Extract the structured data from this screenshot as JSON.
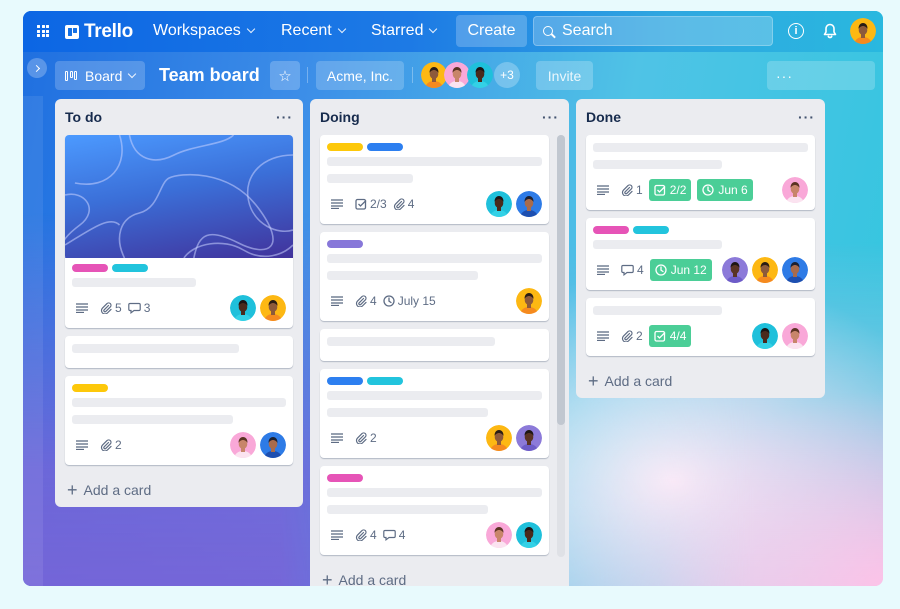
{
  "topnav": {
    "app_name": "Trello",
    "links": [
      {
        "label": "Workspaces"
      },
      {
        "label": "Recent"
      },
      {
        "label": "Starred"
      }
    ],
    "create_label": "Create",
    "search_placeholder": "Search",
    "icons": [
      "apps-grid-icon",
      "trello-logo-icon",
      "search-icon",
      "info-icon",
      "bell-icon",
      "user-avatar"
    ]
  },
  "boardbar": {
    "view_label": "Board",
    "board_title": "Team board",
    "workspace_label": "Acme, Inc.",
    "members_extra": "+3",
    "invite_label": "Invite",
    "menu_label": "···",
    "star_icon": "☆"
  },
  "colors": {
    "label_pink": "#e654b7",
    "label_cyan": "#22c4dd",
    "label_yellow": "#fdc80a",
    "label_blue": "#2d7ff0",
    "label_purple": "#8777d9",
    "badge_green": "#4bce97",
    "list_bg": "#ebecf0"
  },
  "lists": [
    {
      "title": "To do",
      "menu": "···",
      "add_card_label": "Add a card",
      "cards": [
        {
          "cover": true,
          "labels": [
            "pink",
            "cyan"
          ],
          "lines": [
            0.58
          ],
          "attachments": "5",
          "comments": "3",
          "members": [
            "teal-woman",
            "yellow-woman"
          ]
        },
        {
          "lines": [
            0.78
          ]
        },
        {
          "labels": [
            "yellow"
          ],
          "lines": [
            1.0,
            0.75
          ],
          "attachments": "2",
          "members": [
            "pink-man",
            "blue-man"
          ]
        }
      ]
    },
    {
      "title": "Doing",
      "menu": "···",
      "add_card_label": "Add a card",
      "cards": [
        {
          "labels": [
            "yellow",
            "blue"
          ],
          "lines": [
            1.0,
            0.4
          ],
          "checklist": "2/3",
          "attachments": "4",
          "members": [
            "teal-woman",
            "blue-man"
          ]
        },
        {
          "labels": [
            "purple"
          ],
          "lines": [
            1.0,
            0.7
          ],
          "attachments": "4",
          "due": "July 15",
          "members": [
            "yellow-woman"
          ]
        },
        {
          "lines": [
            0.78
          ]
        },
        {
          "labels": [
            "blue",
            "cyan"
          ],
          "lines": [
            1.0,
            0.75
          ],
          "attachments": "2",
          "members": [
            "yellow-woman",
            "purple-man"
          ]
        },
        {
          "labels": [
            "pink"
          ],
          "lines": [
            1.0,
            0.75
          ],
          "attachments": "4",
          "comments": "4",
          "members": [
            "pink-man",
            "teal-woman"
          ]
        }
      ]
    },
    {
      "title": "Done",
      "menu": "···",
      "add_card_label": "Add a card",
      "cards": [
        {
          "lines": [
            1.0,
            0.6
          ],
          "attachments": "1",
          "checklist_done": "2/2",
          "due_done": "Jun 6",
          "members": [
            "pink-man"
          ]
        },
        {
          "labels": [
            "pink",
            "cyan"
          ],
          "lines": [
            0.6
          ],
          "comments": "4",
          "due_done": "Jun 12",
          "members": [
            "purple-man",
            "yellow-woman",
            "blue-man"
          ]
        },
        {
          "lines": [
            0.6
          ],
          "attachments": "2",
          "checklist_done": "4/4",
          "members": [
            "teal-woman",
            "pink-man"
          ]
        }
      ]
    }
  ]
}
